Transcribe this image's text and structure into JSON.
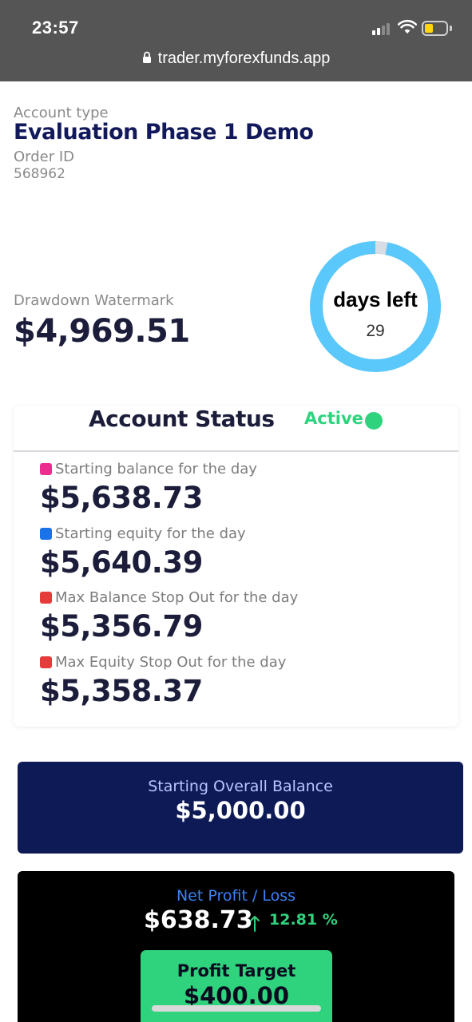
{
  "status_bar": {
    "time": "23:57",
    "battery_level": 0.4,
    "battery_color": "#ffd60a"
  },
  "browser": {
    "url": "trader.myforexfunds.app"
  },
  "account": {
    "type_label": "Account type",
    "type": "Evaluation Phase 1 Demo",
    "order_label": "Order ID",
    "order_id": "568962"
  },
  "drawdown": {
    "label": "Drawdown Watermark",
    "value": "$4,969.51"
  },
  "days_left": {
    "label": "days left",
    "value": "29",
    "progress_remaining": 0.97,
    "ring_color": "#5bc8fb"
  },
  "account_status": {
    "title": "Account Status",
    "state": "Active",
    "state_color": "#2fd37e",
    "metrics": [
      {
        "label": "Starting balance for the day",
        "value": "$5,638.73",
        "color": "#ec2d8f"
      },
      {
        "label": "Starting equity for the day",
        "value": "$5,640.39",
        "color": "#1a73e8"
      },
      {
        "label": "Max Balance Stop Out for the day",
        "value": "$5,356.79",
        "color": "#e53b3b"
      },
      {
        "label": "Max Equity Stop Out for the day",
        "value": "$5,358.37",
        "color": "#e53b3b"
      }
    ]
  },
  "overall_balance": {
    "label": "Starting Overall Balance",
    "value": "$5,000.00"
  },
  "net_profit": {
    "label": "Net Profit / Loss",
    "value": "$638.73",
    "change": "12.81 %",
    "direction": "up-arrow-icon"
  },
  "profit_target": {
    "label": "Profit Target",
    "value": "$400.00"
  }
}
